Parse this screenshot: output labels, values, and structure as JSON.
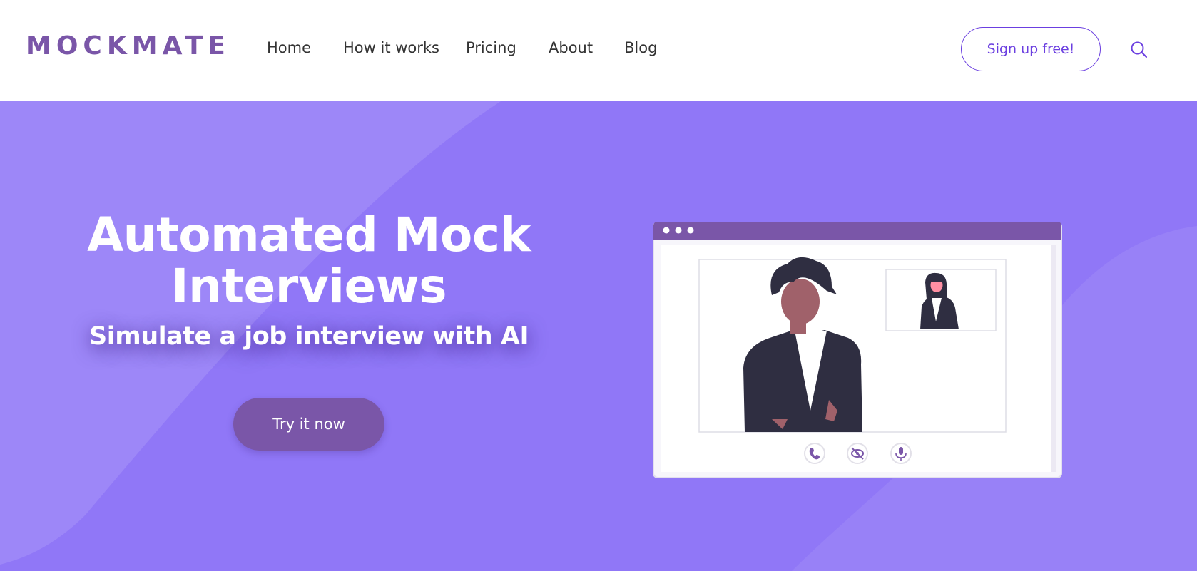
{
  "header": {
    "logo": "MOCKMATE",
    "nav": [
      {
        "label": "Home"
      },
      {
        "label": "How it works"
      },
      {
        "label": "Pricing"
      },
      {
        "label": "About"
      },
      {
        "label": "Blog"
      }
    ],
    "signup_label": "Sign up free!",
    "search_icon": "search-icon"
  },
  "hero": {
    "title_line1": "Automated Mock",
    "title_line2": "Interviews",
    "subtitle": "Simulate a job interview with AI",
    "cta_label": "Try it now"
  },
  "illustration": {
    "controls": [
      "phone-icon",
      "eye-off-icon",
      "microphone-icon"
    ]
  },
  "colors": {
    "brand": "#7a56a8",
    "accent": "#6b3fe0",
    "hero_bg": "#9077f7",
    "text": "#333333",
    "white": "#ffffff"
  }
}
